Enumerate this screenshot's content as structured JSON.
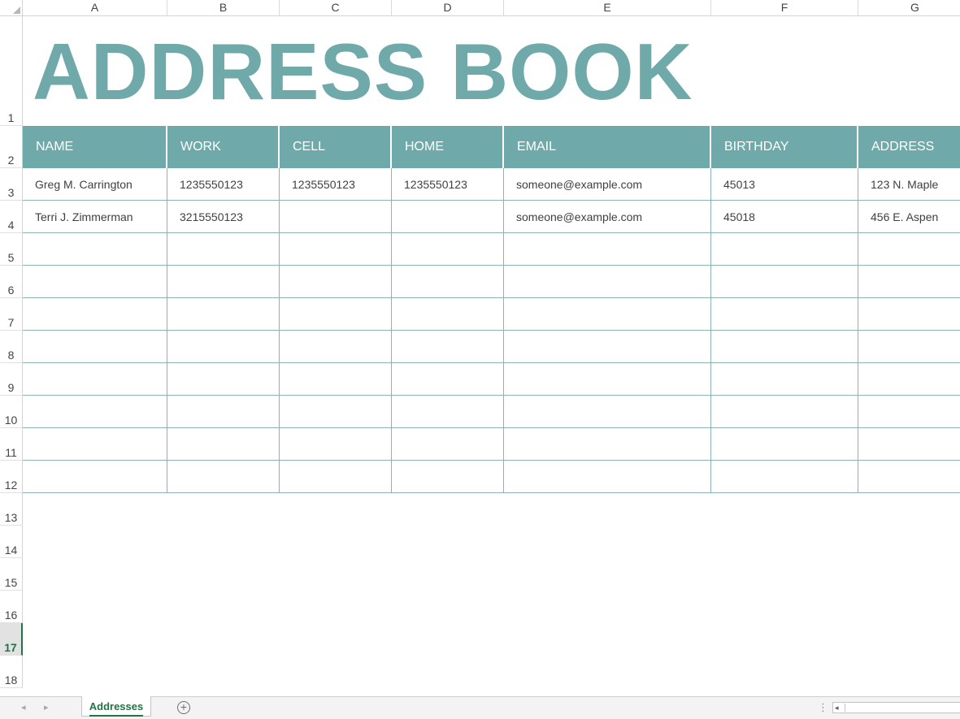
{
  "columns": [
    "A",
    "B",
    "C",
    "D",
    "E",
    "F",
    "G"
  ],
  "rows": [
    "1",
    "2",
    "3",
    "4",
    "5",
    "6",
    "7",
    "8",
    "9",
    "10",
    "11",
    "12",
    "13",
    "14",
    "15",
    "16",
    "17",
    "18"
  ],
  "active_row": "17",
  "title": "ADDRESS BOOK",
  "headers": [
    "NAME",
    "WORK",
    "CELL",
    "HOME",
    "EMAIL",
    "BIRTHDAY",
    "ADDRESS"
  ],
  "entries": [
    [
      "Greg M. Carrington",
      "1235550123",
      "1235550123",
      "1235550123",
      "someone@example.com",
      "45013",
      "123 N. Maple"
    ],
    [
      "Terri J. Zimmerman",
      "3215550123",
      "",
      "",
      "someone@example.com",
      "45018",
      "456 E. Aspen"
    ],
    [
      "",
      "",
      "",
      "",
      "",
      "",
      ""
    ],
    [
      "",
      "",
      "",
      "",
      "",
      "",
      ""
    ],
    [
      "",
      "",
      "",
      "",
      "",
      "",
      ""
    ],
    [
      "",
      "",
      "",
      "",
      "",
      "",
      ""
    ],
    [
      "",
      "",
      "",
      "",
      "",
      "",
      ""
    ],
    [
      "",
      "",
      "",
      "",
      "",
      "",
      ""
    ],
    [
      "",
      "",
      "",
      "",
      "",
      "",
      ""
    ],
    [
      "",
      "",
      "",
      "",
      "",
      "",
      ""
    ]
  ],
  "sheet_tab": "Addresses",
  "add_sheet_glyph": "+",
  "nav_left_glyph": "◂",
  "nav_right_glyph": "▸",
  "more_glyph": "⋮",
  "scroll_left_glyph": "◂",
  "colors": {
    "accent": "#70a9a9",
    "excel_green": "#217346"
  },
  "icons": {
    "add_sheet": "plus-circle-icon",
    "prev_sheet": "chevron-left-icon",
    "next_sheet": "chevron-right-icon"
  }
}
